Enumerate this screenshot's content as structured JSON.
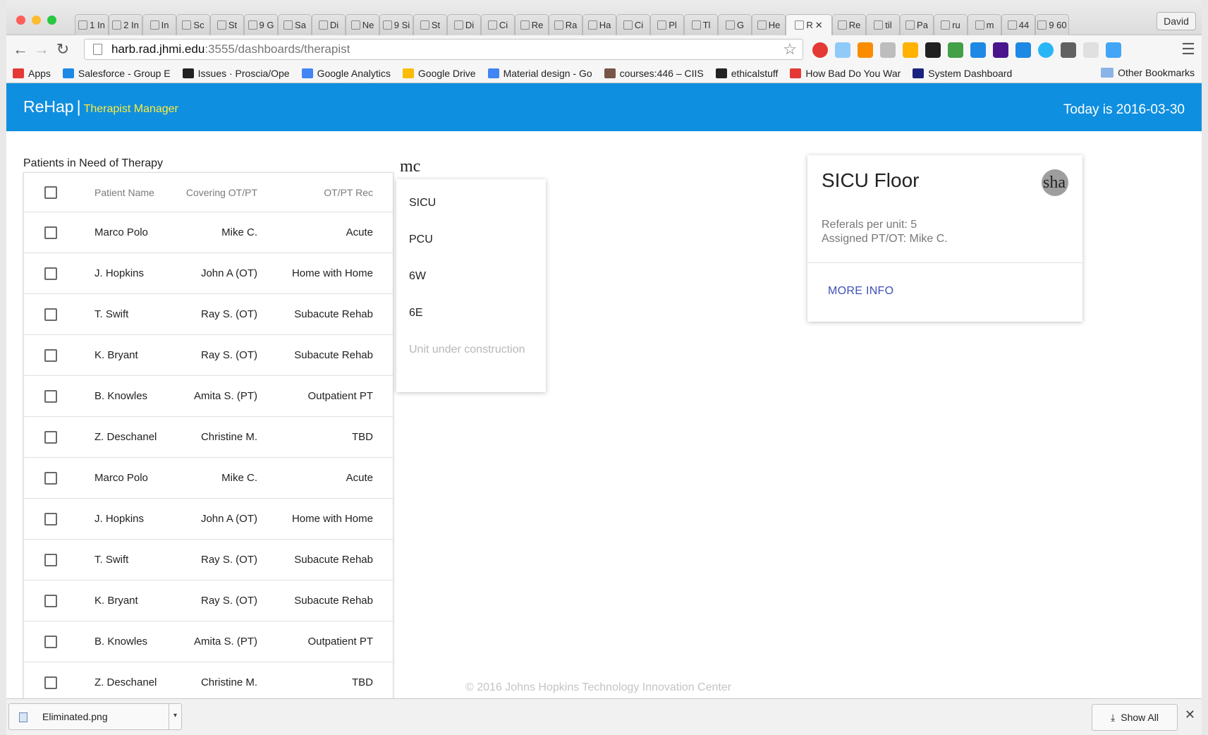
{
  "browser": {
    "tabs": [
      {
        "label": "1 In"
      },
      {
        "label": "2 In"
      },
      {
        "label": "In"
      },
      {
        "label": "Sc"
      },
      {
        "label": "St"
      },
      {
        "label": "9 G"
      },
      {
        "label": "Sa"
      },
      {
        "label": "Di"
      },
      {
        "label": "Ne"
      },
      {
        "label": "9 Si"
      },
      {
        "label": "St"
      },
      {
        "label": "Di"
      },
      {
        "label": "Ci"
      },
      {
        "label": "Re"
      },
      {
        "label": "Ra"
      },
      {
        "label": "Ha"
      },
      {
        "label": "Ci"
      },
      {
        "label": "Pl"
      },
      {
        "label": "Tl"
      },
      {
        "label": "G"
      },
      {
        "label": "He"
      },
      {
        "label": "R"
      },
      {
        "label": "Re"
      },
      {
        "label": "til"
      },
      {
        "label": "Pa"
      },
      {
        "label": "ru"
      },
      {
        "label": "m"
      },
      {
        "label": "44"
      },
      {
        "label": "9 60"
      }
    ],
    "active_tab_index": 21,
    "profile_name": "David",
    "url_host": "harb.rad.jhmi.edu",
    "url_path": ":3555/dashboards/therapist",
    "bookmarks": [
      {
        "label": "Apps",
        "color": "#e53935"
      },
      {
        "label": "Salesforce - Group E",
        "color": "#1e88e5"
      },
      {
        "label": "Issues · Proscia/Ope",
        "color": "#222222"
      },
      {
        "label": "Google Analytics",
        "color": "#4285f4"
      },
      {
        "label": "Google Drive",
        "color": "#fbbc05"
      },
      {
        "label": "Material design - Go",
        "color": "#4285f4"
      },
      {
        "label": "courses:446 – CIIS",
        "color": "#795548"
      },
      {
        "label": "ethicalstuff",
        "color": "#222222"
      },
      {
        "label": "How Bad Do You War",
        "color": "#e53935"
      },
      {
        "label": "System Dashboard",
        "color": "#1a237e"
      }
    ],
    "other_bookmarks": "Other Bookmarks"
  },
  "app": {
    "brand": "ReHap",
    "separator": "|",
    "subtitle": "Therapist Manager",
    "today": "Today is 2016-03-30",
    "accent": "#0f8fe0"
  },
  "patients": {
    "title": "Patients in Need of Therapy",
    "headers": {
      "name": "Patient Name",
      "covering": "Covering OT/PT",
      "rec": "OT/PT Rec"
    },
    "rows": [
      {
        "name": "Marco Polo",
        "covering": "Mike C.",
        "rec": "Acute"
      },
      {
        "name": "J. Hopkins",
        "covering": "John A (OT)",
        "rec": "Home with Home"
      },
      {
        "name": "T. Swift",
        "covering": "Ray S. (OT)",
        "rec": "Subacute Rehab"
      },
      {
        "name": "K. Bryant",
        "covering": "Ray S. (OT)",
        "rec": "Subacute Rehab"
      },
      {
        "name": "B. Knowles",
        "covering": "Amita S. (PT)",
        "rec": "Outpatient PT"
      },
      {
        "name": "Z. Deschanel",
        "covering": "Christine M.",
        "rec": "TBD"
      },
      {
        "name": "Marco Polo",
        "covering": "Mike C.",
        "rec": "Acute"
      },
      {
        "name": "J. Hopkins",
        "covering": "John A (OT)",
        "rec": "Home with Home"
      },
      {
        "name": "T. Swift",
        "covering": "Ray S. (OT)",
        "rec": "Subacute Rehab"
      },
      {
        "name": "K. Bryant",
        "covering": "Ray S. (OT)",
        "rec": "Subacute Rehab"
      },
      {
        "name": "B. Knowles",
        "covering": "Amita S. (PT)",
        "rec": "Outpatient PT"
      },
      {
        "name": "Z. Deschanel",
        "covering": "Christine M.",
        "rec": "TBD"
      }
    ]
  },
  "units_menu": {
    "label": "mc",
    "items": [
      {
        "label": "SICU",
        "disabled": false
      },
      {
        "label": "PCU",
        "disabled": false
      },
      {
        "label": "6W",
        "disabled": false
      },
      {
        "label": "6E",
        "disabled": false
      },
      {
        "label": "Unit under construction",
        "disabled": true
      }
    ]
  },
  "floor_card": {
    "title": "SICU Floor",
    "avatar_text": "sha",
    "referrals": "Referals per unit: 5",
    "assigned": "Assigned PT/OT: Mike C.",
    "action": "MORE INFO"
  },
  "footer": "© 2016 Johns Hopkins Technology Innovation Center",
  "downloads": {
    "file": "Eliminated.png",
    "show_all": "Show All"
  }
}
